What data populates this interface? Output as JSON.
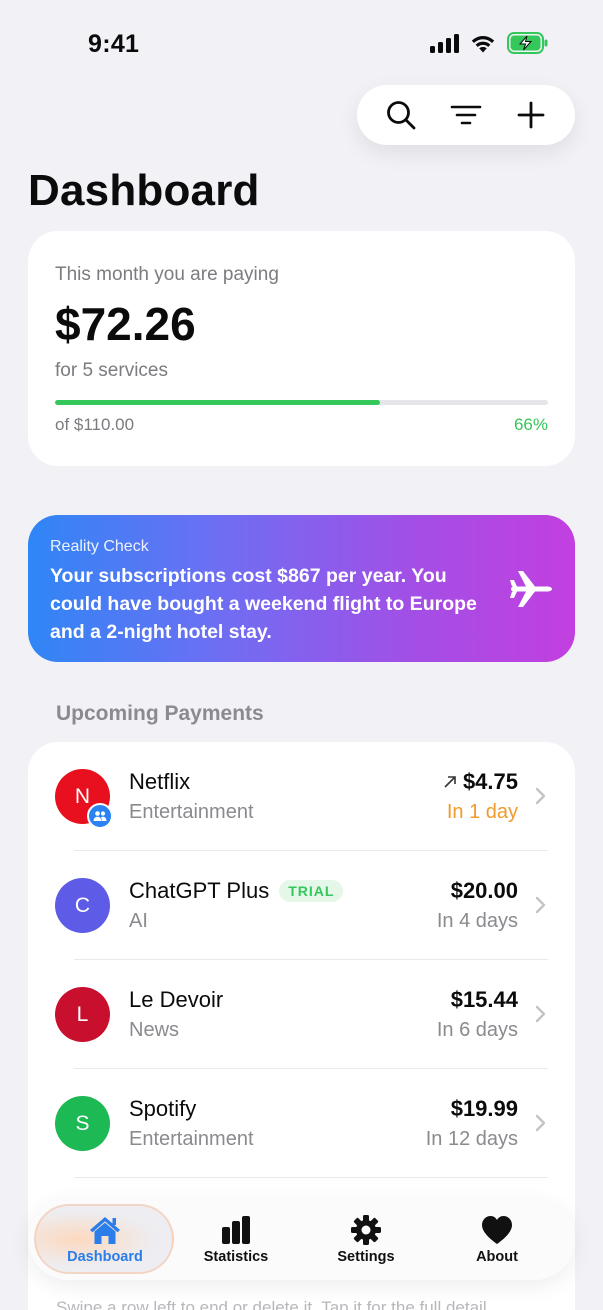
{
  "status_bar": {
    "time": "9:41"
  },
  "header": {
    "title": "Dashboard"
  },
  "summary": {
    "label": "This month you are paying",
    "amount": "$72.26",
    "services": "for 5 services",
    "budget": "of $110.00",
    "percent": "66%",
    "progress": 0.66
  },
  "reality": {
    "kicker": "Reality Check",
    "text": "Your subscriptions cost $867 per year. You could have bought a weekend flight to Europe and a 2-night hotel stay."
  },
  "upcoming": {
    "title": "Upcoming Payments",
    "items": [
      {
        "initial": "N",
        "name": "Netflix",
        "category": "Entertainment",
        "price": "$4.75",
        "due": "In 1 day",
        "color": "#e8101e",
        "shared": true,
        "trend": true
      },
      {
        "initial": "C",
        "name": "ChatGPT Plus",
        "badge": "TRIAL",
        "category": "AI",
        "price": "$20.00",
        "due": "In 4 days",
        "color": "#5e5ce6"
      },
      {
        "initial": "L",
        "name": "Le Devoir",
        "category": "News",
        "price": "$15.44",
        "due": "In 6 days",
        "color": "#c8102e"
      },
      {
        "initial": "S",
        "name": "Spotify",
        "category": "Entertainment",
        "price": "$19.99",
        "due": "In 12 days",
        "color": "#1db954"
      }
    ]
  },
  "hint": "Swipe a row left to end or delete it. Tap it for the full detail.",
  "tabs": [
    {
      "label": "Dashboard",
      "icon": "house-icon"
    },
    {
      "label": "Statistics",
      "icon": "chart-bars-icon"
    },
    {
      "label": "Settings",
      "icon": "gear-icon"
    },
    {
      "label": "About",
      "icon": "heart-icon"
    }
  ],
  "colors": {
    "accent": "#2b7de9",
    "positive": "#34c759",
    "warning": "#f39a2c"
  }
}
